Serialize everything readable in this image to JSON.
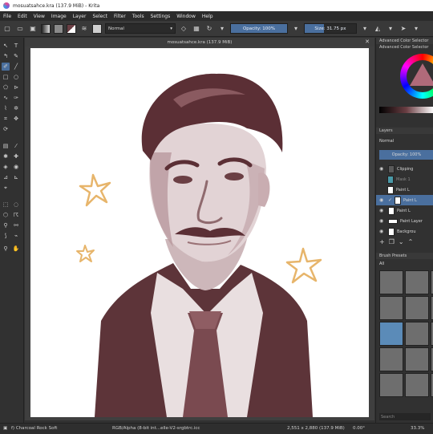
{
  "window": {
    "title": "mosuatsahce.kra (137.9 MiB) - Krita"
  },
  "menu": [
    "File",
    "Edit",
    "View",
    "Image",
    "Layer",
    "Select",
    "Filter",
    "Tools",
    "Settings",
    "Window",
    "Help"
  ],
  "toolbar": {
    "blend_mode": "Normal",
    "opacity_label": "Opacity: 100%",
    "opacity_value": 1.0,
    "size_label": "Size: 31.75 px"
  },
  "document": {
    "tab_title": "mosuatsahce.kra (137.9 MiB)"
  },
  "dock": {
    "color_selector_title": "Advanced Color Selector",
    "color_selector_tab": "Advanced Color Selector",
    "layers_title": "Layers",
    "layers_blend": "Normal",
    "layers_opacity": "Opacity: 100%",
    "layers": [
      {
        "name": "Clipping",
        "selected": false,
        "checked": false
      },
      {
        "name": "Mask 1",
        "selected": false,
        "checked": false
      },
      {
        "name": "Paint L",
        "selected": false,
        "checked": false
      },
      {
        "name": "Paint L",
        "selected": true,
        "checked": true
      },
      {
        "name": "Paint L",
        "selected": false,
        "checked": false
      },
      {
        "name": "Paint Layer",
        "selected": false,
        "checked": false
      },
      {
        "name": "Backgrou",
        "selected": false,
        "checked": false
      }
    ],
    "brush_presets_title": "Brush Presets",
    "brush_tag": "All",
    "brush_search": "Search"
  },
  "status": {
    "brush": "f) Charcoal Rock Soft",
    "color_space": "RGB/Alpha (8-bit int...elle-V2-srgbtrc.icc",
    "image_size": "2,551 x 2,880 (137.9 MiB)",
    "rotation": "0.00°",
    "zoom": "33.3%"
  },
  "colors": {
    "accent": "#4a6f9e",
    "ink": "#6b3f44",
    "star": "#e7b56b"
  }
}
